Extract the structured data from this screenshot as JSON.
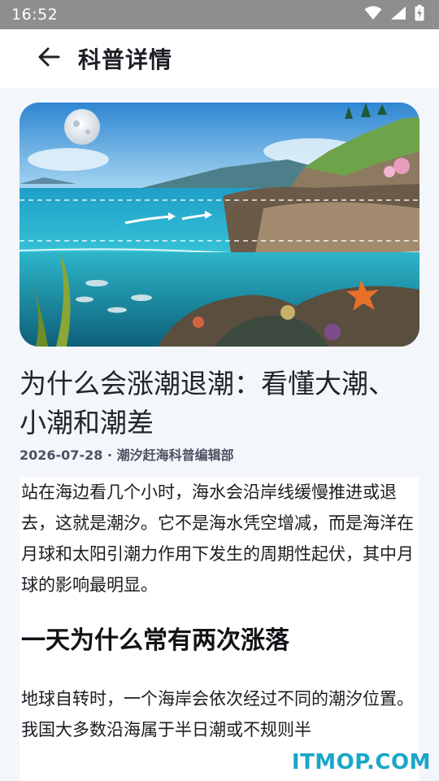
{
  "status_bar": {
    "time": "16:52",
    "icons": [
      "wifi-icon",
      "signal-icon",
      "battery-charging-icon"
    ]
  },
  "app_bar": {
    "back_icon": "arrow-left-icon",
    "title": "科普详情"
  },
  "article": {
    "hero_image": "seaside-tide-illustration",
    "title": "为什么会涨潮退潮：看懂大潮、小潮和潮差",
    "meta": "2026-07-28 · 潮汐赶海科普编辑部",
    "paragraph_1": "站在海边看几个小时，海水会沿岸线缓慢推进或退去，这就是潮汐。它不是海水凭空增减，而是海洋在月球和太阳引潮力作用下发生的周期性起伏，其中月球的影响最明显。",
    "section_heading": "一天为什么常有两次涨落",
    "paragraph_2": "地球自转时，一个海岸会依次经过不同的潮汐位置。我国大多数沿海属于半日潮或不规则半"
  },
  "watermark": "ITMOP.COM",
  "colors": {
    "status_bar": "#8e8e90",
    "app_bar": "#ffffff",
    "page_background": "#f3f6fb",
    "watermark": "#1aa6c8"
  }
}
